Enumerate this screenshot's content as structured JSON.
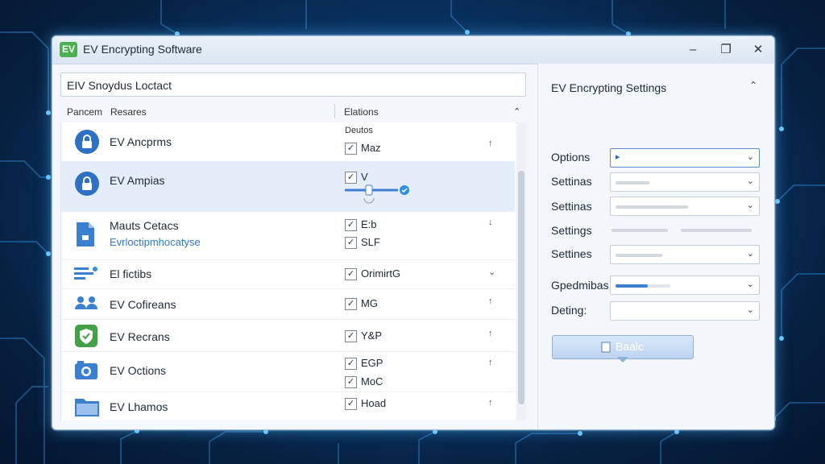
{
  "window": {
    "badge": "EV",
    "title": "EV Encrypting Software"
  },
  "left": {
    "search_value": "EIV Snoydus Loctact",
    "columns": {
      "c1": "Pancem",
      "c2": "Resares",
      "c3": "Elations"
    },
    "rows": [
      {
        "name": "EV Ancprms",
        "sub_head": "Deutos",
        "checks": [
          "Maz"
        ],
        "arrow": "↑"
      },
      {
        "name": "EV Ampias",
        "checks": [
          "V"
        ],
        "arrow": ""
      },
      {
        "name": "Mauts Cetacs",
        "sub": "Evrloctipmhocatyse",
        "checks": [
          "E:b",
          "SLF"
        ],
        "arrow": "↓"
      },
      {
        "name": "El fictibs",
        "checks": [
          "OrimirtG"
        ],
        "arrow": "⌄"
      },
      {
        "name": "EV Cofireans",
        "checks": [
          "MG"
        ],
        "arrow": "↑"
      },
      {
        "name": "EV Recrans",
        "checks": [
          "Y&P"
        ],
        "arrow": "↑"
      },
      {
        "name": "EV Octions",
        "checks": [
          "EGP",
          "MoC"
        ],
        "arrow": "↑"
      },
      {
        "name": "EV Lhamos",
        "checks": [
          "Hoad"
        ],
        "arrow": "↑"
      }
    ]
  },
  "right": {
    "title": "EV Encrypting Settings",
    "labels": [
      "Options",
      "Settinas",
      "Settinas",
      "Settings",
      "Settines",
      "Gpedmibas",
      "Deting:"
    ],
    "back_label": "Baalc"
  }
}
